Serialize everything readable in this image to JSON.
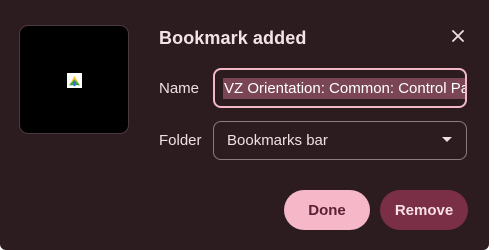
{
  "dialog": {
    "title": "Bookmark added",
    "close_icon": "close-icon",
    "preview": {
      "favicon": "site-favicon-icon"
    },
    "name_label": "Name",
    "name_value": "VZ Orientation: Common: Control Panel:",
    "folder_label": "Folder",
    "folder_value": "Bookmarks bar",
    "folder_dropdown_icon": "dropdown-arrow-icon",
    "done_label": "Done",
    "remove_label": "Remove"
  },
  "colors": {
    "dialog_background": "#2c1c20",
    "accent": "#f2b8c6",
    "selection_highlight": "#7a4656",
    "done_button": "#f6b7c9",
    "remove_button": "#7b2f47"
  }
}
